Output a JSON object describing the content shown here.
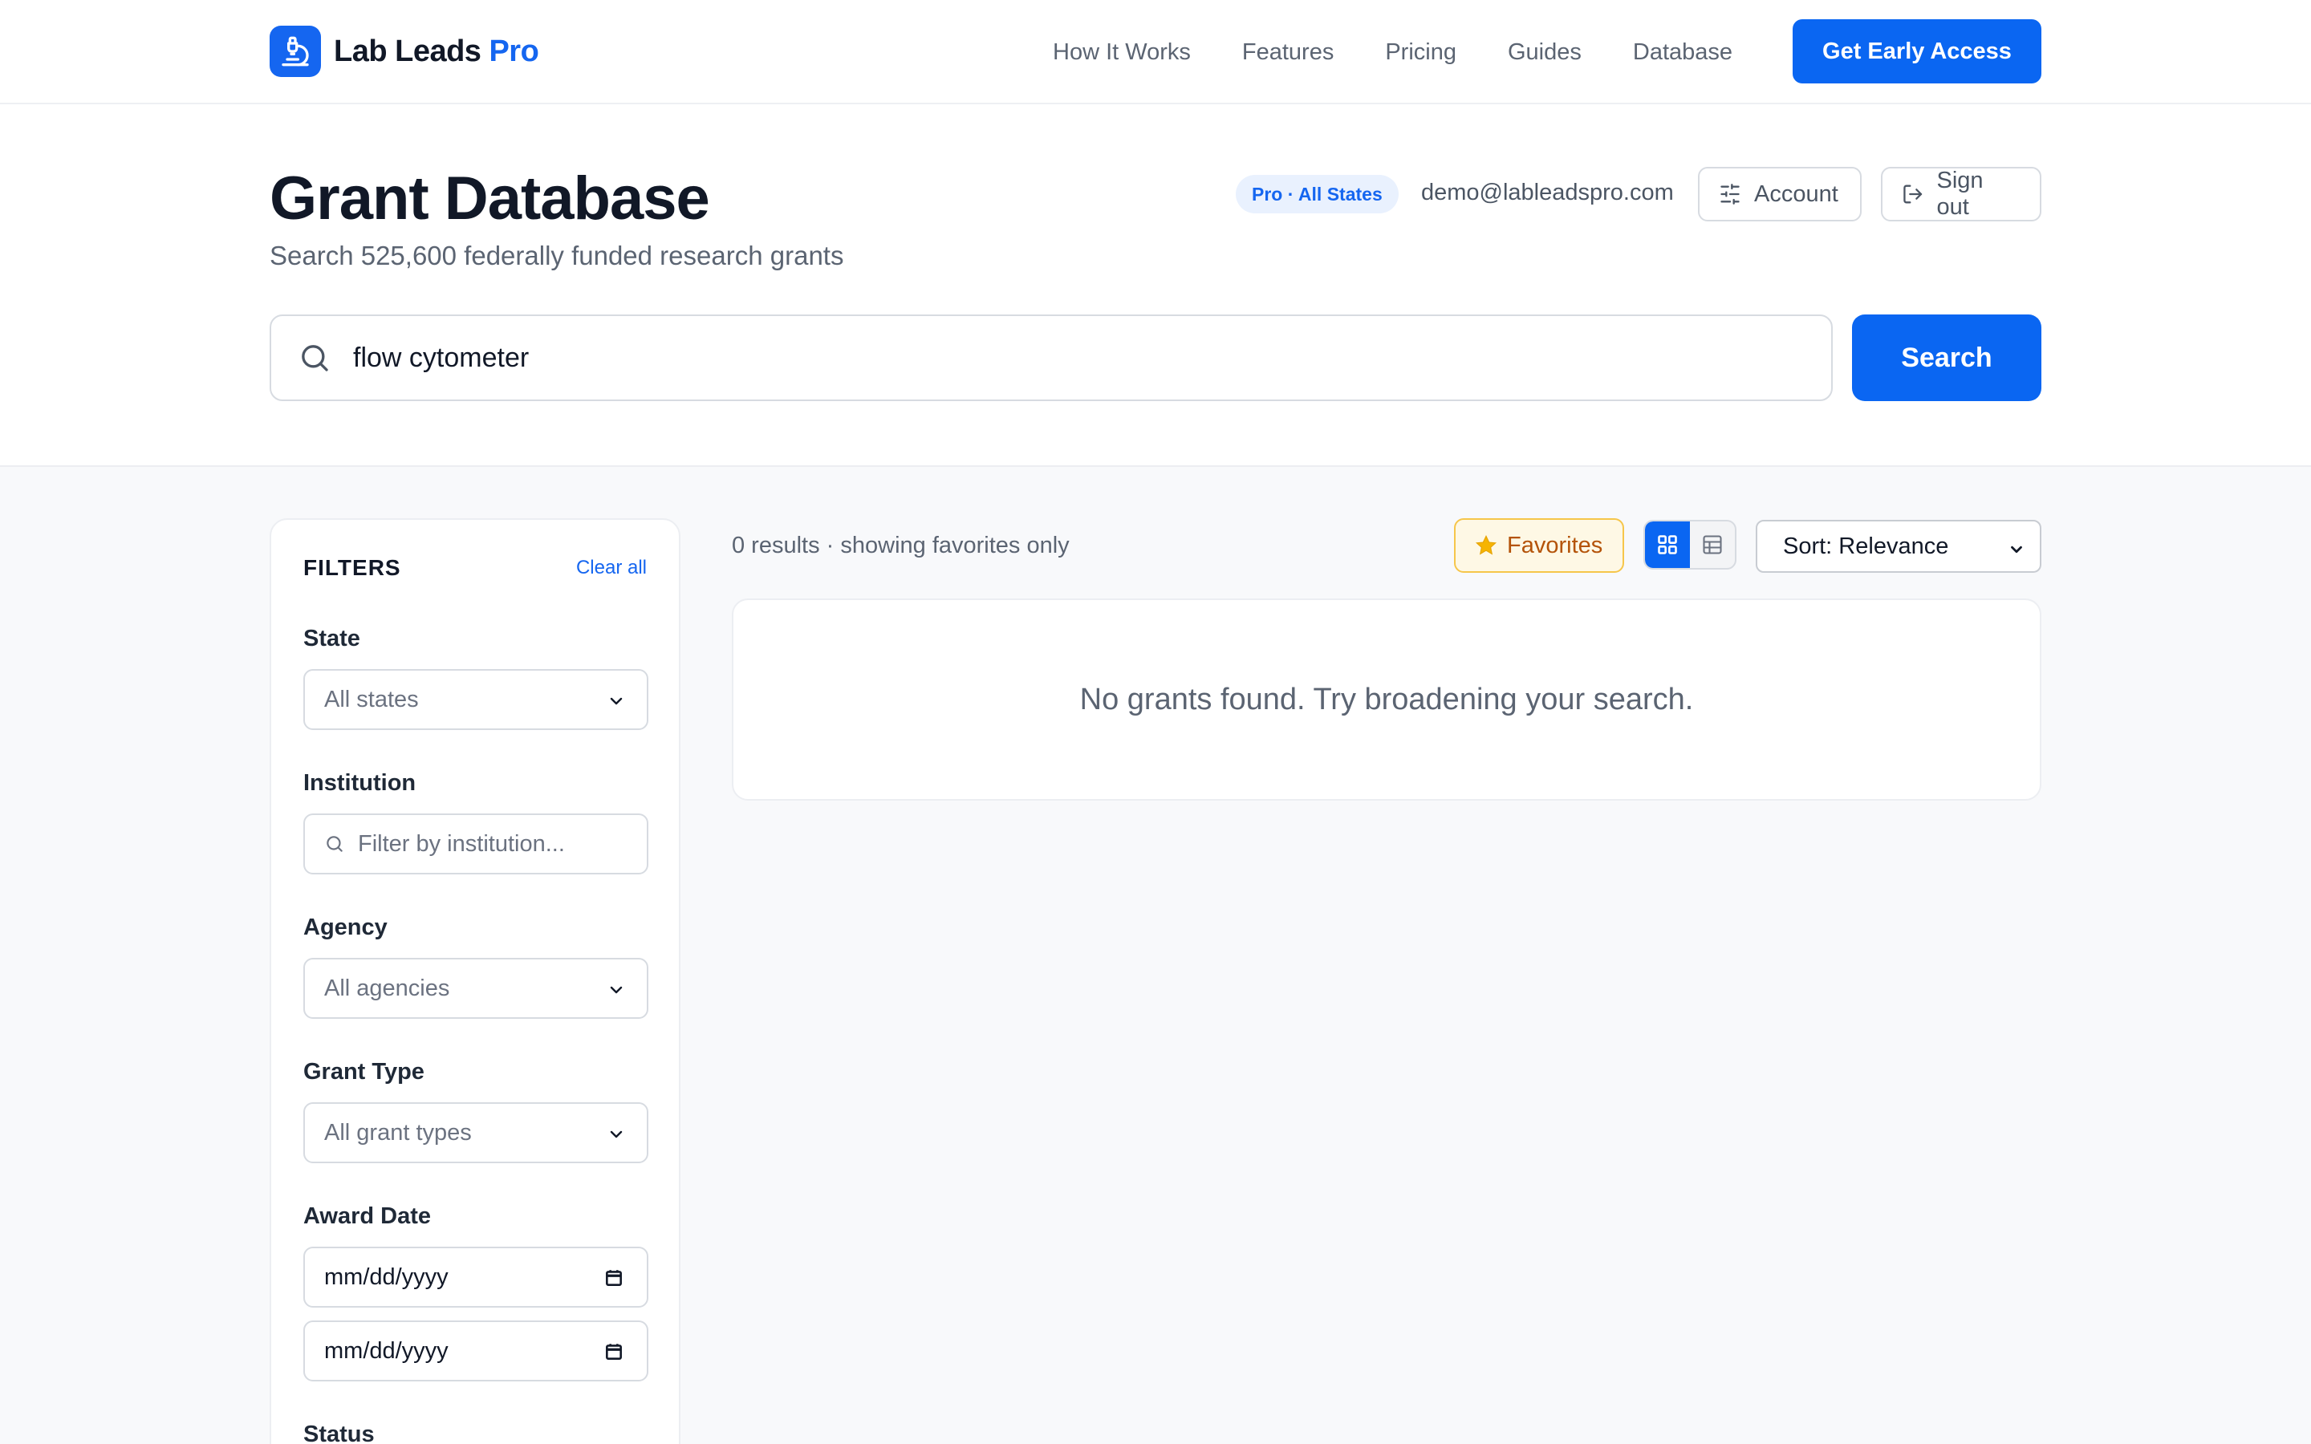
{
  "nav": {
    "brand_name": "Lab Leads",
    "brand_accent": "Pro",
    "links": [
      "How It Works",
      "Features",
      "Pricing",
      "Guides",
      "Database"
    ],
    "cta_label": "Get Early Access"
  },
  "header": {
    "title": "Grant Database",
    "subtitle": "Search 525,600 federally funded research grants",
    "plan_badge": "Pro · All States",
    "user_email": "demo@lableadspro.com",
    "account_label": "Account",
    "signout_label": "Sign out"
  },
  "search": {
    "value": "flow cytometer",
    "button_label": "Search"
  },
  "filters": {
    "title": "FILTERS",
    "clear_label": "Clear all",
    "state_label": "State",
    "state_value": "All states",
    "institution_label": "Institution",
    "institution_placeholder": "Filter by institution...",
    "agency_label": "Agency",
    "agency_value": "All agencies",
    "grant_type_label": "Grant Type",
    "grant_type_value": "All grant types",
    "award_date_label": "Award Date",
    "date_from": "mm/dd/yyyy",
    "date_to": "mm/dd/yyyy",
    "status_label": "Status"
  },
  "results": {
    "summary": "0 results · showing favorites only",
    "favorites_label": "Favorites",
    "sort_value": "Sort: Relevance",
    "empty_message": "No grants found. Try broadening your search."
  },
  "colors": {
    "primary": "#0a66f2",
    "favorites_accent": "#f6b400"
  }
}
